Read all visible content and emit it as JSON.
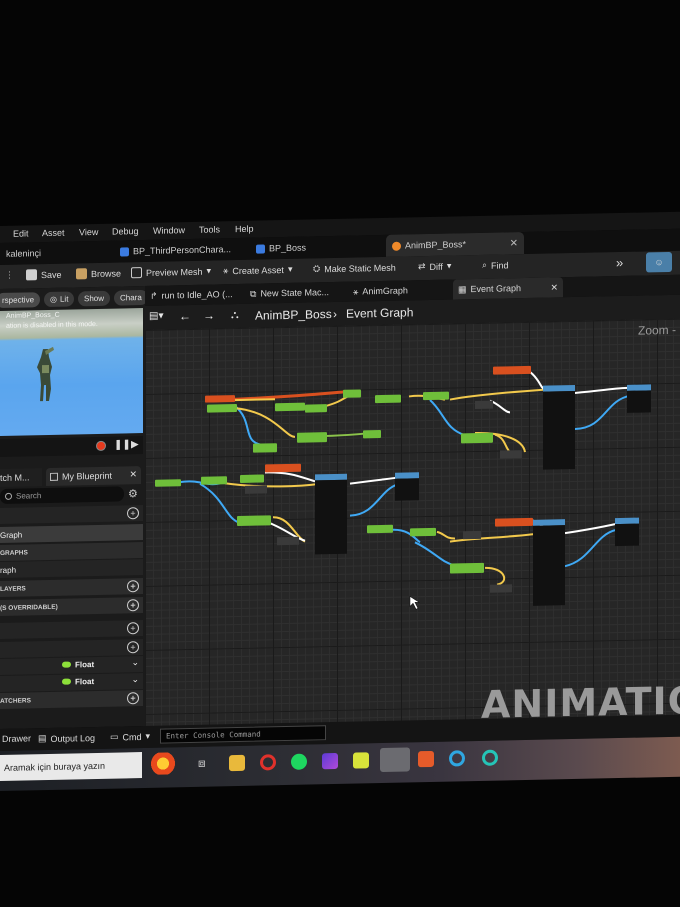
{
  "menu": [
    "Edit",
    "Asset",
    "View",
    "Debug",
    "Window",
    "Tools",
    "Help"
  ],
  "project_name": "kaleninçi",
  "editor_tabs": [
    {
      "label": "BP_ThirdPersonChara...",
      "active": false
    },
    {
      "label": "BP_Boss",
      "active": false
    },
    {
      "label": "AnimBP_Boss*",
      "active": true
    }
  ],
  "toolbar": {
    "save": "Save",
    "browse": "Browse",
    "preview_mesh": "Preview Mesh",
    "create_asset": "Create Asset",
    "make_static_mesh": "Make Static Mesh",
    "diff": "Diff",
    "find": "Find"
  },
  "viewport": {
    "perspective": "rspective",
    "lit": "Lit",
    "show": "Show",
    "chara": "Chara",
    "title": "AnimBP_Boss_C",
    "subtitle": "ation is disabled in this mode."
  },
  "left_panel": {
    "tab_a": "tch M...",
    "tab_b": "My Blueprint",
    "search_placeholder": "Search",
    "rows": [
      {
        "label": "Graph",
        "kind": "item"
      },
      {
        "label": "GRAPHS",
        "kind": "sect"
      },
      {
        "label": "raph",
        "kind": "item"
      },
      {
        "label": "LAYERS",
        "kind": "sect"
      },
      {
        "label": "(S OVERRIDABLE)",
        "kind": "sect"
      }
    ],
    "var_type_1": "Float",
    "var_type_2": "Float",
    "dispatchers": "ATCHERS"
  },
  "graph_tabs": [
    {
      "label": "run to Idle_AO (...",
      "active": false
    },
    {
      "label": "New State Mac...",
      "active": false
    },
    {
      "label": "AnimGraph",
      "active": false
    },
    {
      "label": "Event Graph",
      "active": true
    }
  ],
  "breadcrumb": {
    "root": "AnimBP_Boss",
    "current": "Event Graph"
  },
  "zoom_label": "Zoom -",
  "watermark": "ANIMATION",
  "bottom": {
    "drawer": "Drawer",
    "output_log": "Output Log",
    "cmd": "Cmd",
    "console_placeholder": "Enter Console Command"
  },
  "taskbar": {
    "search": "Aramak için buraya yazın"
  },
  "colors": {
    "exec_wire": "#ffffff",
    "float_wire": "#f2c94c",
    "object_wire": "#3fa9f5",
    "bool_wire": "#8bc34a",
    "node_header_event": "#d9501f",
    "node_header_pure": "#6fbf3a",
    "node_header_func": "#4a90c8"
  }
}
